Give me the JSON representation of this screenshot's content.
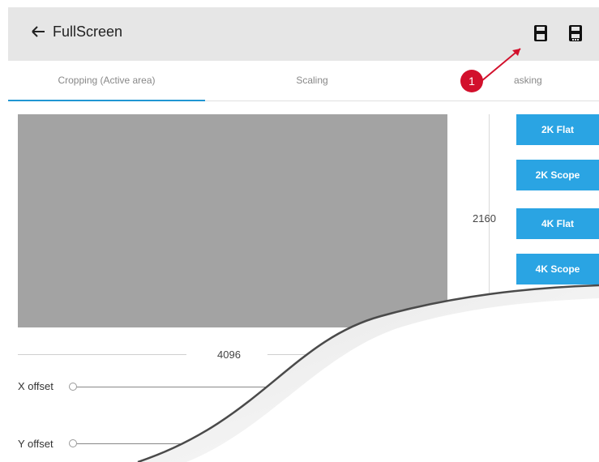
{
  "header": {
    "title": "FullScreen",
    "back_icon": "arrow-left-icon",
    "save_icon": "floppy-disk-icon",
    "save_as_icon": "floppy-disk-plus-icon"
  },
  "tabs": [
    {
      "label": "Cropping (Active area)",
      "active": true
    },
    {
      "label": "Scaling",
      "active": false
    },
    {
      "label": "asking",
      "active": false
    }
  ],
  "callout": {
    "number": "1",
    "color": "#d2102c"
  },
  "crop": {
    "height_value": "2160",
    "width_value": "4096"
  },
  "presets": [
    {
      "label": "2K Flat"
    },
    {
      "label": "2K Scope"
    },
    {
      "label": "4K Flat"
    },
    {
      "label": "4K Scope"
    }
  ],
  "offsets": {
    "x_label": "X offset",
    "x_value": "0",
    "y_label": "Y offset"
  },
  "colors": {
    "accent": "#2196d3",
    "preset_button": "#2aa4e3",
    "header_bg": "#e6e6e6",
    "preview_bg": "#a3a3a3"
  }
}
